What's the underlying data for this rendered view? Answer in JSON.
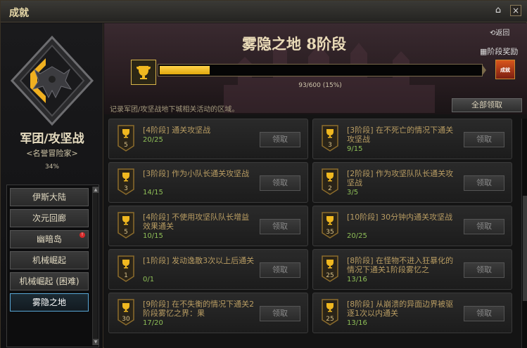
{
  "window": {
    "title": "成就",
    "close_label": "×",
    "home_icon": "home-icon"
  },
  "left": {
    "category_title": "军团/攻坚战",
    "category_subtitle": "<名誉冒险家>",
    "category_percent": "34%",
    "nav": [
      {
        "label": "伊斯大陆",
        "active": false,
        "alert": false
      },
      {
        "label": "次元回廊",
        "active": false,
        "alert": false
      },
      {
        "label": "幽暗岛",
        "active": false,
        "alert": true
      },
      {
        "label": "机械崛起",
        "active": false,
        "alert": false
      },
      {
        "label": "机械崛起 (困难)",
        "active": false,
        "alert": false
      },
      {
        "label": "雾隐之地",
        "active": true,
        "alert": false
      }
    ],
    "alert_mark": "!"
  },
  "main": {
    "stage_title": "雾隐之地  8阶段",
    "back_label": "返回",
    "reward_label": "阶段奖励",
    "progress_text": "93/600 (15%)",
    "progress_fraction": 0.155,
    "reward_icon_text": "成就",
    "description": "记录军团/攻坚战地下城相关活动的区域。",
    "claim_all_label": "全部领取"
  },
  "achievements": [
    {
      "level": "5",
      "text": "[4阶段] 通关攻坚战",
      "count": "20/25",
      "button": "领取"
    },
    {
      "level": "3",
      "text": "[3阶段] 在不死亡的情况下通关攻坚战",
      "count": "9/15",
      "button": "领取"
    },
    {
      "level": "3",
      "text": "[3阶段] 作为小队长通关攻坚战",
      "count": "14/15",
      "button": "领取"
    },
    {
      "level": "2",
      "text": "[2阶段] 作为攻坚队队长通关攻坚战",
      "count": "3/5",
      "button": "领取"
    },
    {
      "level": "5",
      "text": "[4阶段] 不使用攻坚队队长增益效果通关",
      "count": "10/15",
      "button": "领取"
    },
    {
      "level": "35",
      "text": "[10阶段] 30分钟内通关攻坚战",
      "count": "20/25",
      "button": "领取"
    },
    {
      "level": "1",
      "text": "[1阶段] 发动逸散3次以上后通关",
      "count": "0/1",
      "button": "领取"
    },
    {
      "level": "25",
      "text": "[8阶段] 在怪物不进入狂暴化的情况下通关1阶段雾忆之",
      "count": "13/16",
      "button": "领取"
    },
    {
      "level": "30",
      "text": "[9阶段] 在不失衡的情况下通关2阶段雾忆之界：果",
      "count": "17/20",
      "button": "领取"
    },
    {
      "level": "25",
      "text": "[8阶段] 从崩溃的异面边界被驱逐1次以内通关",
      "count": "13/16",
      "button": "领取"
    }
  ],
  "colors": {
    "accent_gold": "#f0b820",
    "count_green": "#8fbf57",
    "active_blue": "#59a7d6"
  }
}
